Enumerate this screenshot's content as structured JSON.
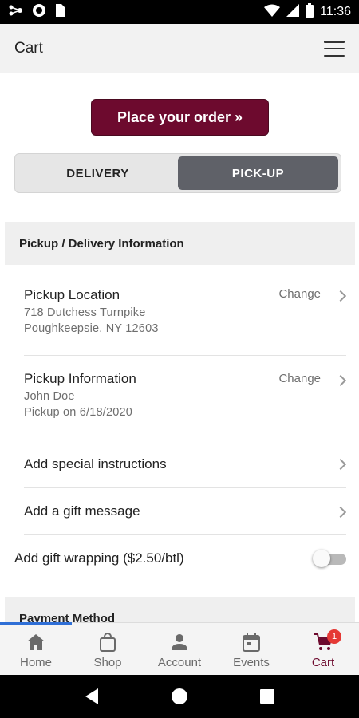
{
  "status_bar": {
    "time": "11:36",
    "icons": [
      "network-icon",
      "circle-app-icon",
      "sim-card-icon",
      "wifi-icon",
      "signal-icon",
      "battery-icon"
    ]
  },
  "header": {
    "title": "Cart",
    "menu_icon": "hamburger-menu-icon"
  },
  "order": {
    "place_order_label": "Place your order »",
    "brand_color": "#6d0a2e"
  },
  "mode_toggle": {
    "options": [
      {
        "label": "DELIVERY",
        "active": false
      },
      {
        "label": "PICK-UP",
        "active": true
      }
    ],
    "active_color": "#5f6168"
  },
  "pickup_section": {
    "header": "Pickup / Delivery Information",
    "location": {
      "title": "Pickup Location",
      "line1": "718 Dutchess Turnpike",
      "line2": "Poughkeepsie, NY 12603",
      "action": "Change"
    },
    "info": {
      "title": "Pickup Information",
      "line1": "John Doe",
      "line2": "Pickup on 6/18/2020",
      "action": "Change"
    },
    "special_instructions": "Add special instructions",
    "gift_message": "Add a gift message",
    "gift_wrapping": {
      "label": "Add gift wrapping ($2.50/btl)",
      "enabled": false
    }
  },
  "payment_section": {
    "header": "Payment Method"
  },
  "bottom_nav": {
    "items": [
      {
        "label": "Home",
        "icon": "home-icon"
      },
      {
        "label": "Shop",
        "icon": "shopping-bag-icon"
      },
      {
        "label": "Account",
        "icon": "person-icon"
      },
      {
        "label": "Events",
        "icon": "calendar-icon"
      },
      {
        "label": "Cart",
        "icon": "cart-icon",
        "active": true,
        "badge": "1"
      }
    ],
    "active_color": "#6d0a2e",
    "badge_color": "#e53935"
  },
  "android_nav": {
    "buttons": [
      "back-icon",
      "home-circle-icon",
      "recents-icon"
    ]
  }
}
